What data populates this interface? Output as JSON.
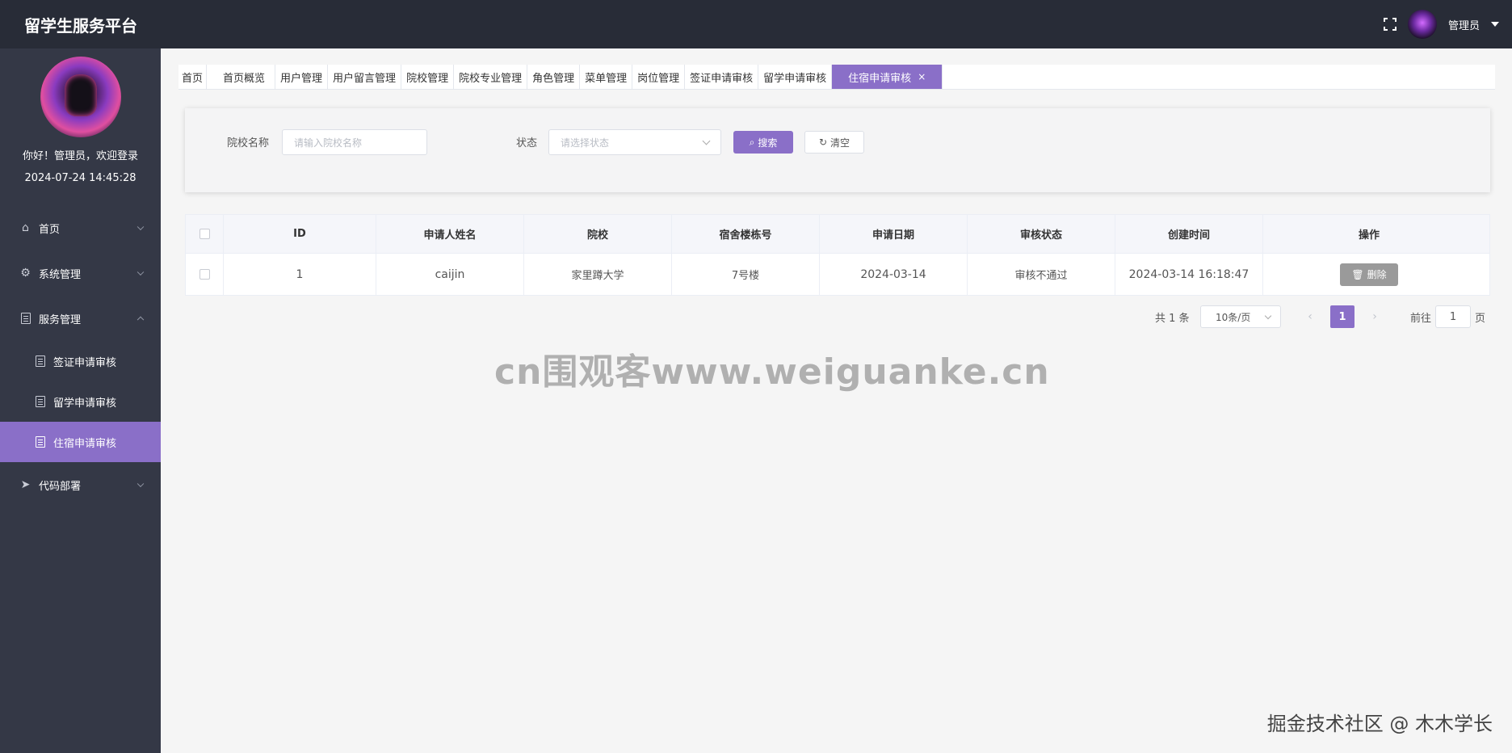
{
  "header": {
    "title": "留学生服务平台",
    "user_name": "管理员"
  },
  "sidebar": {
    "greeting": "你好！管理员，欢迎登录",
    "datetime": "2024-07-24 14:45:28",
    "menu": [
      {
        "label": "首页",
        "icon": "home-icon"
      },
      {
        "label": "系统管理",
        "icon": "gear-icon"
      },
      {
        "label": "服务管理",
        "icon": "document-icon"
      }
    ],
    "submenu": [
      {
        "label": "签证申请审核"
      },
      {
        "label": "留学申请审核"
      },
      {
        "label": "住宿申请审核"
      }
    ],
    "menu_last": {
      "label": "代码部署",
      "icon": "paper-plane-icon"
    }
  },
  "tabs": [
    {
      "label": "首页"
    },
    {
      "label": "首页概览"
    },
    {
      "label": "用户管理"
    },
    {
      "label": "用户留言管理"
    },
    {
      "label": "院校管理"
    },
    {
      "label": "院校专业管理"
    },
    {
      "label": "角色管理"
    },
    {
      "label": "菜单管理"
    },
    {
      "label": "岗位管理"
    },
    {
      "label": "签证申请审核"
    },
    {
      "label": "留学申请审核"
    },
    {
      "label": "住宿申请审核",
      "close": "×"
    }
  ],
  "search": {
    "school_label": "院校名称",
    "school_placeholder": "请输入院校名称",
    "status_label": "状态",
    "status_placeholder": "请选择状态",
    "search_button": "搜索",
    "clear_button": "清空"
  },
  "table": {
    "headers": [
      "ID",
      "申请人姓名",
      "院校",
      "宿舍楼栋号",
      "申请日期",
      "审核状态",
      "创建时间",
      "操作"
    ],
    "rows": [
      {
        "id": "1",
        "name": "caijin",
        "school": "家里蹲大学",
        "building": "7号楼",
        "apply_date": "2024-03-14",
        "status": "审核不通过",
        "created": "2024-03-14 16:18:47",
        "action": "删除"
      }
    ]
  },
  "pagination": {
    "total": "共 1 条",
    "page_size": "10条/页",
    "current_page": "1",
    "goto_label": "前往",
    "goto_value": "1",
    "page_unit": "页"
  },
  "watermark": "cn围观客www.weiguanke.cn",
  "credit": "掘金技术社区 @ 木木学长",
  "colors": {
    "header_bg": "#282c37",
    "sidebar_bg": "#343846",
    "accent": "#8a6fc8",
    "delete_button": "#9a9a9a"
  }
}
